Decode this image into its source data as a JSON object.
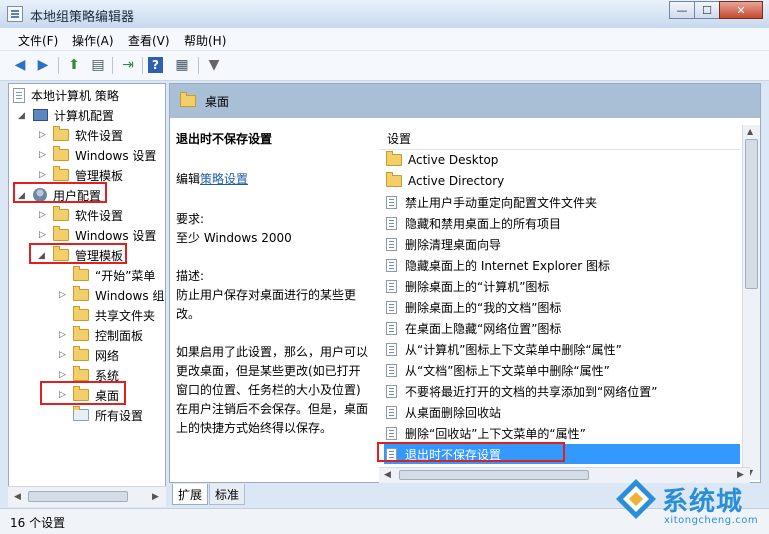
{
  "window": {
    "title": "本地组策略编辑器",
    "min_glyph": "—",
    "max_glyph": "☐",
    "close_glyph": "✕"
  },
  "menu": [
    "文件(F)",
    "操作(A)",
    "查看(V)",
    "帮助(H)"
  ],
  "tree": {
    "root": "本地计算机 策略",
    "computer_config": "计算机配置",
    "software_settings": "软件设置",
    "windows_settings": "Windows 设置",
    "admin_templates": "管理模板",
    "user_config": "用户配置",
    "user_software_settings": "软件设置",
    "user_windows_settings": "Windows 设置",
    "user_admin_templates": "管理模板",
    "start_menu": "“开始”菜单",
    "windows_components": "Windows 组件",
    "shared_folders": "共享文件夹",
    "control_panel": "控制面板",
    "network": "网络",
    "system": "系统",
    "desktop": "桌面",
    "all_settings": "所有设置"
  },
  "panel": {
    "header": "桌面"
  },
  "description": {
    "title": "退出时不保存设置",
    "edit_prefix": "编辑",
    "edit_link": "策略设置",
    "requirements_label": "要求:",
    "requirements_value": "至少 Windows 2000",
    "desc_label": "描述:",
    "desc_text1": "防止用户保存对桌面进行的某些更改。",
    "desc_text2": "如果启用了此设置，那么，用户可以更改桌面，但是某些更改(如已打开窗口的位置、任务栏的大小及位置)在用户注销后不会保存。但是，桌面上的快捷方式始终得以保存。"
  },
  "list": {
    "column": "设置",
    "items": [
      {
        "label": "Active Desktop",
        "type": "folder"
      },
      {
        "label": "Active Directory",
        "type": "folder"
      },
      {
        "label": "禁止用户手动重定向配置文件文件夹",
        "type": "setting"
      },
      {
        "label": "隐藏和禁用桌面上的所有项目",
        "type": "setting"
      },
      {
        "label": "删除清理桌面向导",
        "type": "setting"
      },
      {
        "label": "隐藏桌面上的 Internet Explorer 图标",
        "type": "setting"
      },
      {
        "label": "删除桌面上的“计算机”图标",
        "type": "setting"
      },
      {
        "label": "删除桌面上的“我的文档”图标",
        "type": "setting"
      },
      {
        "label": "在桌面上隐藏“网络位置”图标",
        "type": "setting"
      },
      {
        "label": "从“计算机”图标上下文菜单中删除“属性”",
        "type": "setting"
      },
      {
        "label": "从“文档”图标上下文菜单中删除“属性”",
        "type": "setting"
      },
      {
        "label": "不要将最近打开的文档的共享添加到“网络位置”",
        "type": "setting"
      },
      {
        "label": "从桌面删除回收站",
        "type": "setting"
      },
      {
        "label": "删除“回收站”上下文菜单的“属性”",
        "type": "setting"
      },
      {
        "label": "退出时不保存设置",
        "type": "setting",
        "selected": true
      }
    ]
  },
  "tabs": [
    "扩展",
    "标准"
  ],
  "status": "16 个设置",
  "watermark": {
    "brand": "系统城",
    "url": "xitongcheng.com"
  },
  "colors": {
    "selection": "#3399ff",
    "highlight_box": "#e02020",
    "link": "#1f5da8"
  }
}
